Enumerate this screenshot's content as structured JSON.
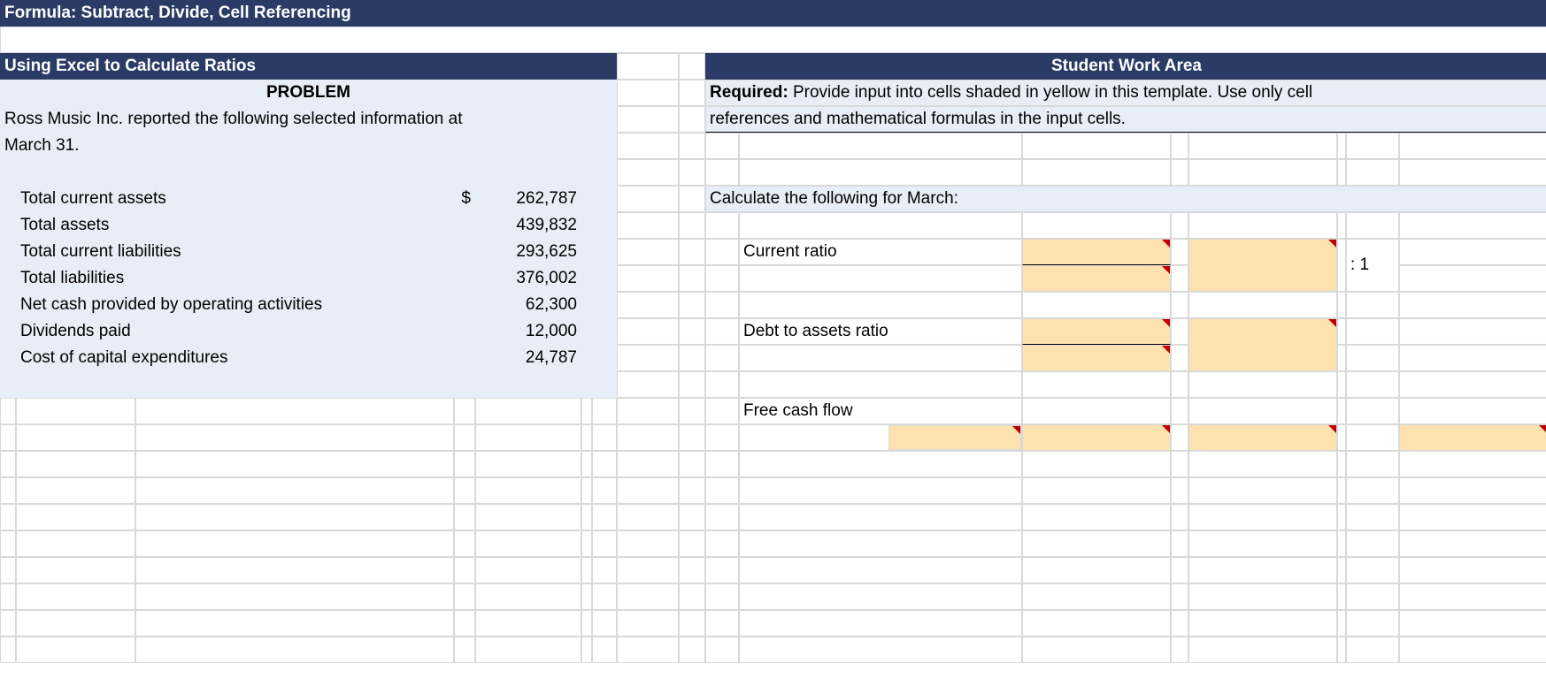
{
  "sheet": {
    "title_bar": "Formula: Subtract, Divide, Cell Referencing",
    "left_header": "Using Excel to Calculate Ratios",
    "problem_label": "PROBLEM",
    "problem_text_l1": "Ross Music Inc. reported the following selected information at",
    "problem_text_l2": "March 31.",
    "fin": {
      "tca_label": "Total current assets",
      "tca_cur": "$",
      "tca_val": "262,787",
      "ta_label": "Total assets",
      "ta_val": "439,832",
      "tcl_label": "Total current liabilities",
      "tcl_val": "293,625",
      "tl_label": "Total liabilities",
      "tl_val": "376,002",
      "ncf_label": "Net cash provided by operating activities",
      "ncf_val": "62,300",
      "div_label": "Dividends paid",
      "div_val": "12,000",
      "cap_label": "Cost of capital expenditures",
      "cap_val": "24,787"
    },
    "right_header": "Student Work Area",
    "req_bold": "Required:",
    "req_rest": " Provide input into cells shaded in yellow in this template. Use only cell",
    "req_l2": "references and mathematical formulas in the input cells.",
    "calc_intro": "Calculate the following for March:",
    "cr_label": "Current ratio",
    "ratio_suffix": ": 1",
    "da_label": "Debt to assets ratio",
    "fcf_label": "Free cash flow"
  }
}
